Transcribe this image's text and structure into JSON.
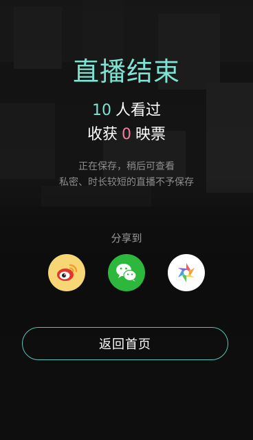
{
  "colors": {
    "accent_teal": "#7fe3d3",
    "accent_pink": "#f07fa0",
    "button_border": "#57c7b6",
    "text_white": "#ffffff",
    "text_muted": "#8e8e8e"
  },
  "live_end": {
    "title": "直播结束",
    "viewer_count": "10",
    "viewer_suffix": "人看过",
    "ticket_prefix": "收获",
    "ticket_count": "0",
    "ticket_suffix": "映票",
    "note_line1": "正在保存，稍后可查看",
    "note_line2": "私密、时长较短的直播不予保存"
  },
  "share": {
    "label": "分享到",
    "targets": [
      {
        "icon": "weibo-icon",
        "color": "#f6d675"
      },
      {
        "icon": "wechat-icon",
        "color": "#2db73c"
      },
      {
        "icon": "moments-icon",
        "color": "#ffffff"
      }
    ]
  },
  "footer": {
    "home_button_label": "返回首页"
  }
}
